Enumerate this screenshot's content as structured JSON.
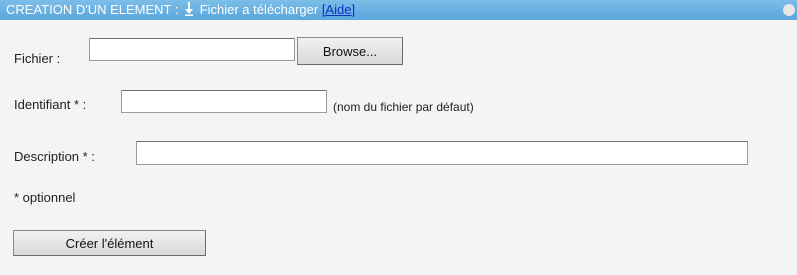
{
  "header": {
    "title_prefix": "CREATION D'UN ELEMENT : ",
    "title_type": " Fichier a télécharger ",
    "help_link": "[Aide]",
    "download_icon": "download-arrow-icon",
    "collapse_icon": "collapse-circle-icon"
  },
  "form": {
    "file_label": "Fichier :",
    "file_value": "",
    "browse_button": "Browse...",
    "identifier_label": "Identifiant * :",
    "identifier_value": "",
    "identifier_hint": "(nom du fichier par défaut)",
    "description_label": "Description * :",
    "description_value": "",
    "optional_note": "* optionnel",
    "submit_button": "Créer l'élément"
  },
  "colors": {
    "header_bg": "#5aa6dc",
    "header_text": "#ffffff",
    "link": "#1030c8",
    "panel_bg": "#f4f4f4"
  }
}
